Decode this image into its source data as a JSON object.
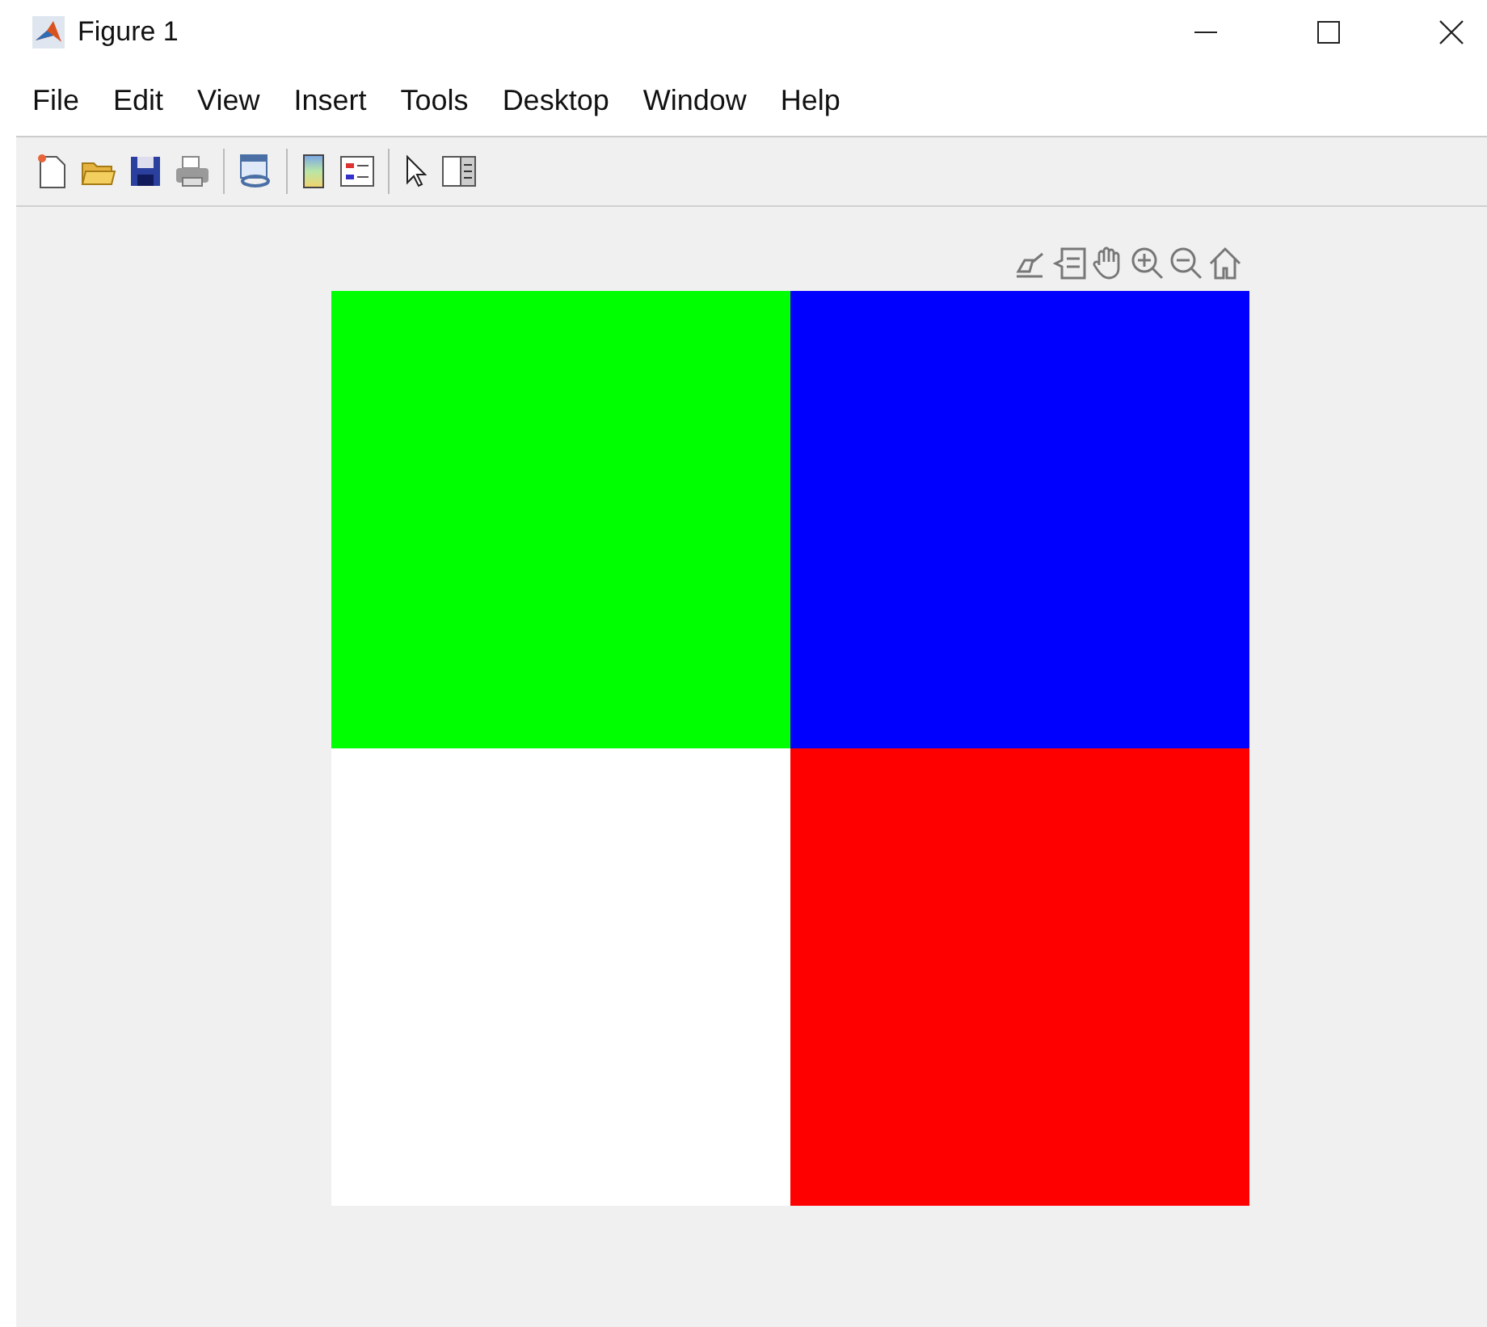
{
  "window": {
    "title": "Figure 1"
  },
  "menu": [
    "File",
    "Edit",
    "View",
    "Insert",
    "Tools",
    "Desktop",
    "Window",
    "Help"
  ],
  "image": {
    "cells": [
      {
        "color": "#00ff00"
      },
      {
        "color": "#0000ff"
      },
      {
        "color": "#ffffff"
      },
      {
        "color": "#ff0000"
      }
    ]
  }
}
